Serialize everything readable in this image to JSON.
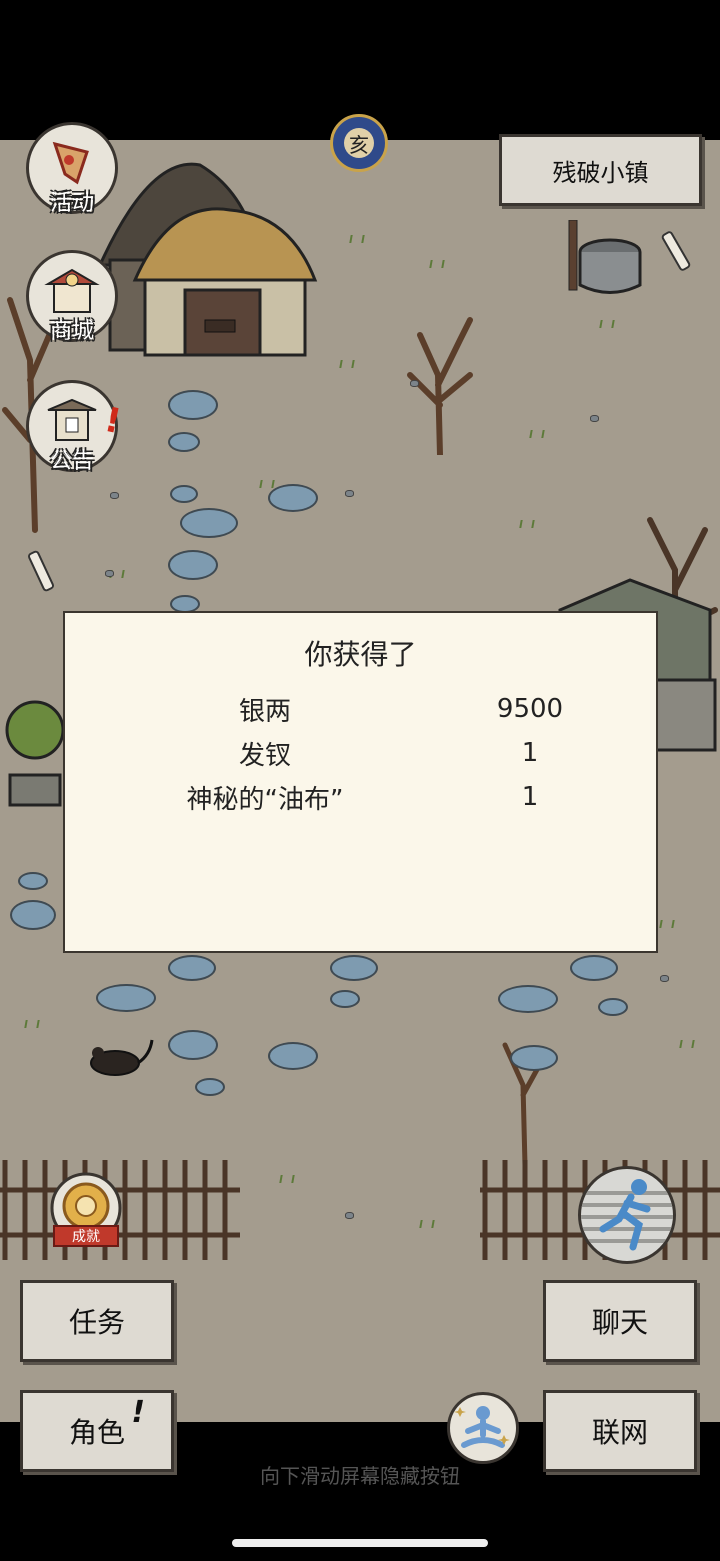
{
  "location": {
    "name": "残破小镇"
  },
  "side_menu": [
    {
      "label": "活动",
      "icon": "flag-icon"
    },
    {
      "label": "商城",
      "icon": "shop-icon"
    },
    {
      "label": "公告",
      "icon": "notice-board-icon"
    }
  ],
  "time_icon": {
    "glyph": "亥",
    "icon": "night-moon-icon"
  },
  "dialog": {
    "title": "你获得了",
    "items": [
      {
        "name": "银两",
        "qty": "9500"
      },
      {
        "name": "发钗",
        "qty": "1"
      },
      {
        "name": "神秘的“油布”",
        "qty": "1"
      }
    ]
  },
  "achievements": {
    "label": "成就"
  },
  "buttons": {
    "tasks": "任务",
    "character": "角色",
    "character_alert": "!",
    "chat": "聊天",
    "network": "联网"
  },
  "hint_text": "向下滑动屏幕隐藏按钮",
  "colors": {
    "ground": "#a49c8e",
    "dialog_bg": "#fbf7ea",
    "button_bg": "#dedad2",
    "stone": "#7e9bb0"
  }
}
